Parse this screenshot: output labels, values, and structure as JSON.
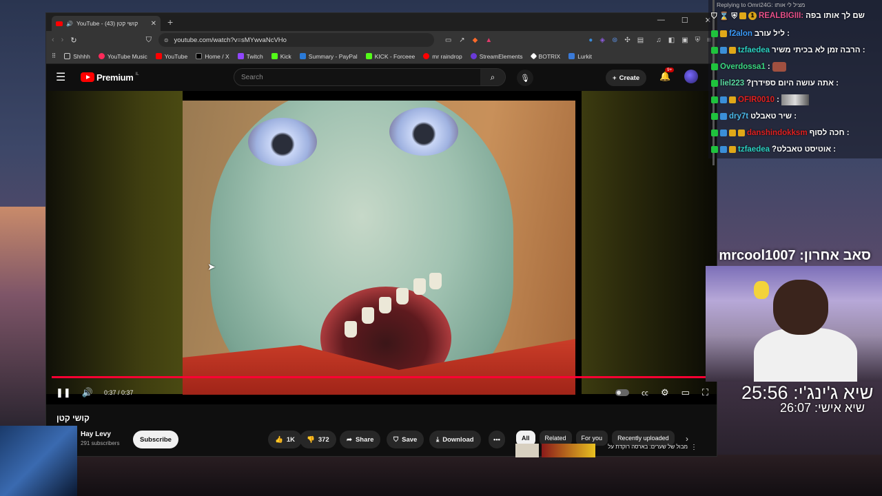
{
  "browser": {
    "tab_title": "YouTube - קושי קטן (43)",
    "url": "youtube.com/watch?v=sMYwvaNcVHo",
    "bookmarks": [
      "Shhhh",
      "YouTube Music",
      "YouTube",
      "Home / X",
      "Twitch",
      "Kick",
      "Summary - PayPal",
      "KICK - Forceee",
      "mr raindrop",
      "StreamElements",
      "BOTRIX",
      "Lurkit"
    ]
  },
  "youtube": {
    "logo_text": "Premium",
    "logo_country": "IL",
    "search_placeholder": "Search",
    "create_label": "Create",
    "notif_badge": "9+",
    "time": "0:37 / 0:37",
    "progress": 1.0,
    "video_title": "קושי קטן",
    "channel_name": "Hay Levy",
    "subscribers": "291 subscribers",
    "subscribe_label": "Subscribe",
    "likes": "1K",
    "dislikes": "372",
    "share_label": "Share",
    "save_label": "Save",
    "download_label": "Download",
    "chips": [
      "All",
      "Related",
      "For you",
      "Recently uploaded"
    ],
    "rec_text": "מבול של שערים: בארסה רוקדת על"
  },
  "chat": {
    "reply_header": "Replying to Omri24G: מציל לי אותו",
    "pinned": "שם לך אותו בפה",
    "pinned_user": "REALBIGIII:",
    "badge_count": "1",
    "messages": [
      {
        "user": "f2alon",
        "text": "ליל עורב :"
      },
      {
        "user": "tzfaedea",
        "text": "הרבה זמן לא בכיתי משיר :"
      },
      {
        "user": "Overdossa1",
        "text": ":"
      },
      {
        "user": "liel223",
        "text": "?אתה עושה היום ספידרן :"
      },
      {
        "user": "OFIR0010",
        "text": ":"
      },
      {
        "user": "dry7t",
        "text": "שיר טאבלט :"
      },
      {
        "user": "danshindokksm",
        "text": "חכה לסוף :"
      },
      {
        "user": "tzfaedea",
        "text": "?אוטיסט טאבלט :"
      }
    ]
  },
  "stream": {
    "last_sub": "סאב אחרון: mrcool1007",
    "timer_record": "שיא ג'ינג'י: 25:56",
    "timer_personal": "שיא אישי: 26:07"
  }
}
